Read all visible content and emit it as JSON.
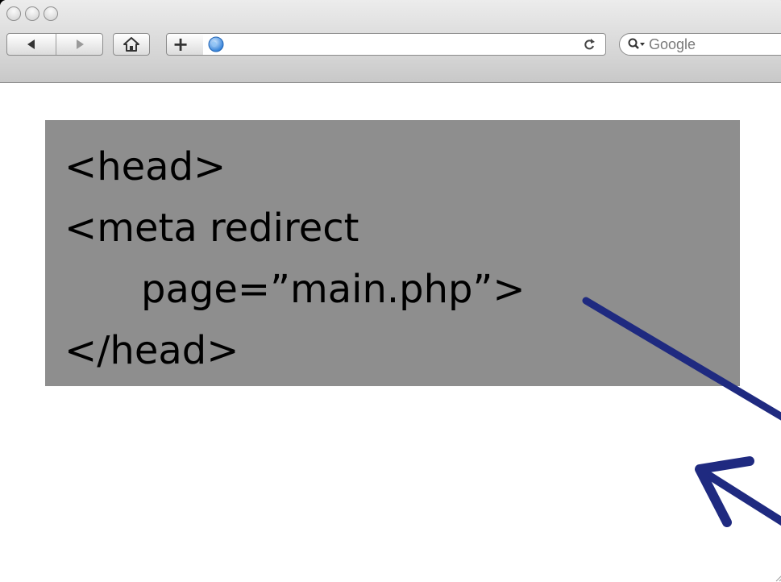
{
  "browser": {
    "toolbar": {
      "back_icon": "back-arrow-icon",
      "forward_icon": "forward-arrow-icon",
      "home_icon": "home-icon",
      "add_bookmark_label": "+",
      "site_icon": "globe-icon",
      "url_value": "",
      "reload_icon": "reload-icon",
      "search_icon": "magnifier-dropdown-icon",
      "search_placeholder": "Google"
    }
  },
  "code_block": {
    "lines": [
      "<head>",
      "<meta redirect",
      "page=”main.php”>",
      "</head>"
    ],
    "background_color": "#8e8e8e"
  },
  "annotation": {
    "arrow_color": "#1f2a80"
  }
}
